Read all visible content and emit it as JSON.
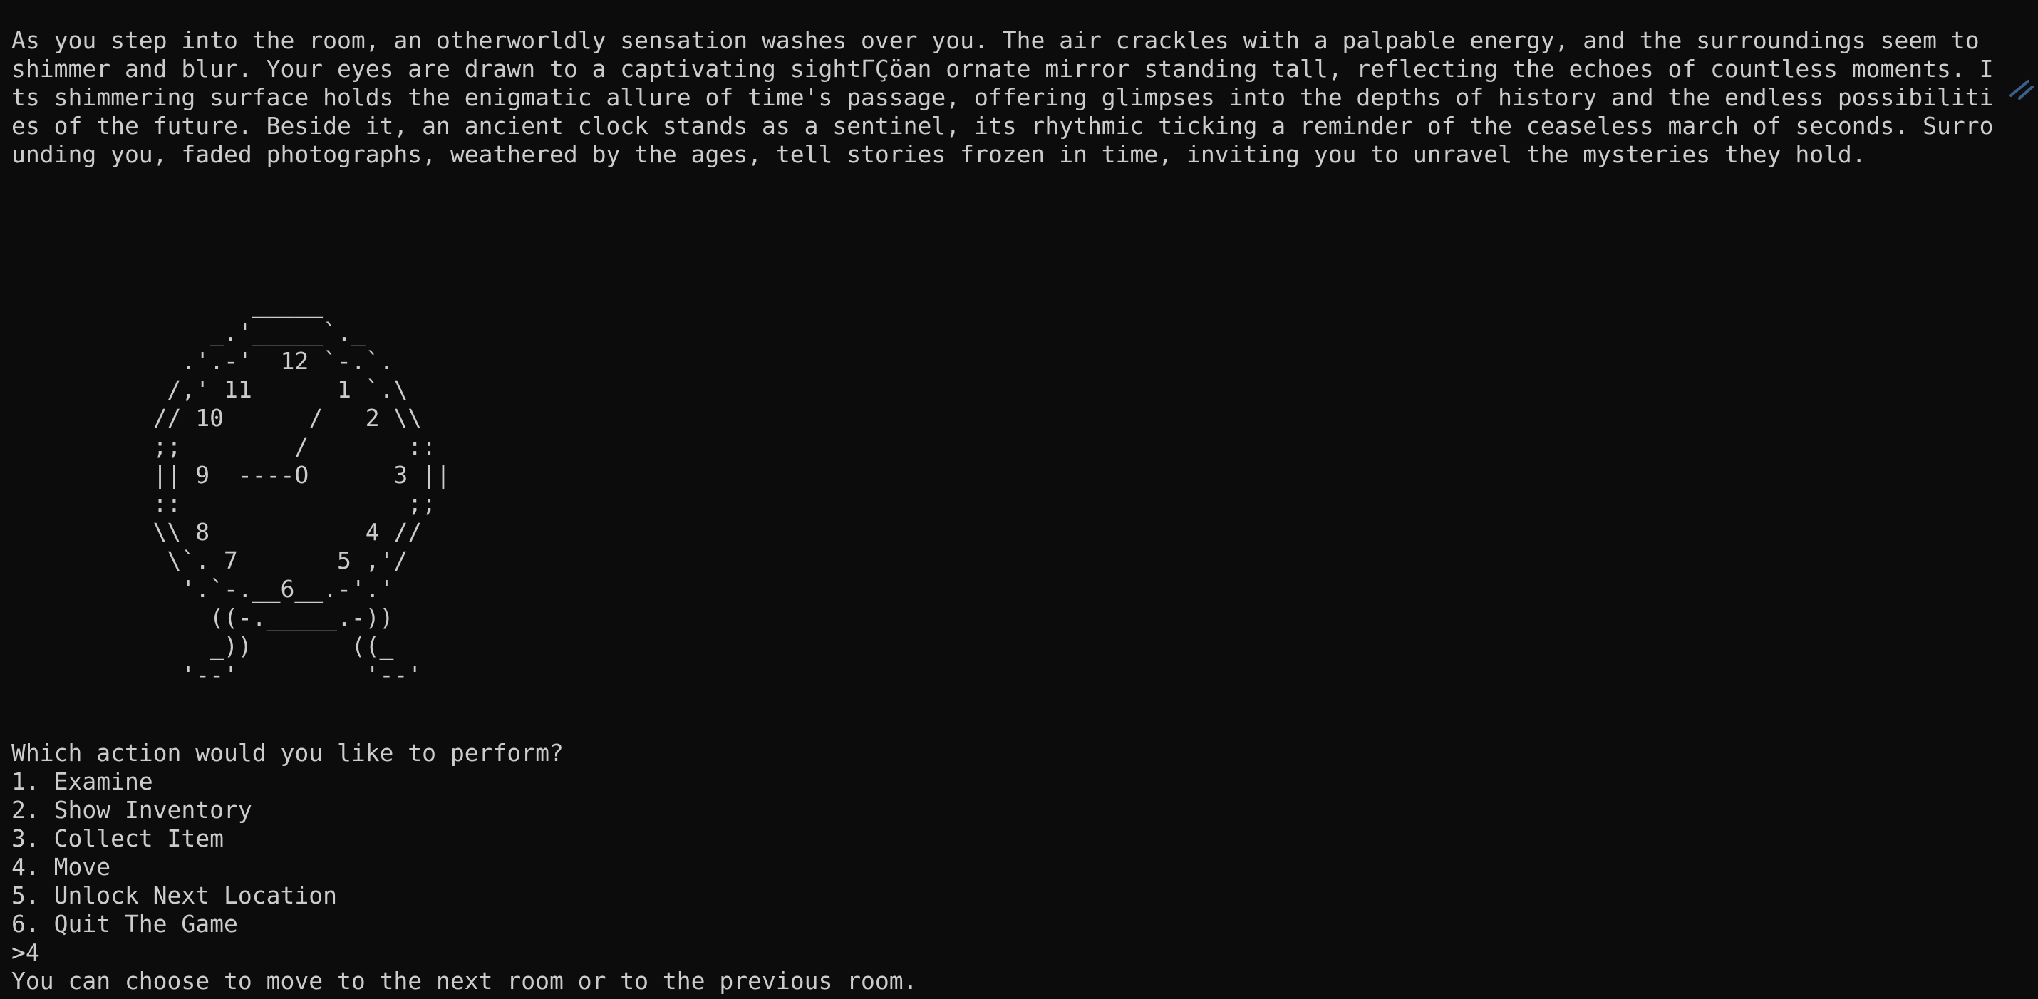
{
  "story": {
    "lines": [
      "As you step into the room, an otherworldly sensation washes over you. The air crackles with a palpable energy, and the surroundings seem to",
      "shimmer and blur. Your eyes are drawn to a captivating sightΓÇöan ornate mirror standing tall, reflecting the echoes of countless moments. I",
      "ts shimmering surface holds the enigmatic allure of time's passage, offering glimpses into the depths of history and the endless possibiliti",
      "es of the future. Beside it, an ancient clock stands as a sentinel, its rhythmic ticking a reminder of the ceaseless march of seconds. Surro",
      "unding you, faded photographs, weathered by the ages, tell stories frozen in time, inviting you to unravel the mysteries they hold."
    ]
  },
  "clock_art": {
    "lines": [
      "                 _____",
      "              _.'_____`._",
      "            .'.-'  12 `-.`.",
      "           /,' 11      1 `.\\",
      "          // 10      /   2 \\\\",
      "          ;;        /       ::",
      "          || 9  ----O      3 ||",
      "          ::                ;;",
      "          \\\\ 8           4 //",
      "           \\`. 7       5 ,'/",
      "            '.`-.__6__.-'.'",
      "              ((-._____.-))",
      "              _))       ((_",
      "            '--'         '--'"
    ]
  },
  "menu": {
    "prompt": "Which action would you like to perform?",
    "options": [
      "1. Examine",
      "2. Show Inventory",
      "3. Collect Item",
      "4. Move",
      "5. Unlock Next Location",
      "6. Quit The Game"
    ],
    "input": ">4",
    "response": "You can choose to move to the next room or to the previous room."
  },
  "colors": {
    "background": "#0c0c0c",
    "text": "#cccccc"
  }
}
